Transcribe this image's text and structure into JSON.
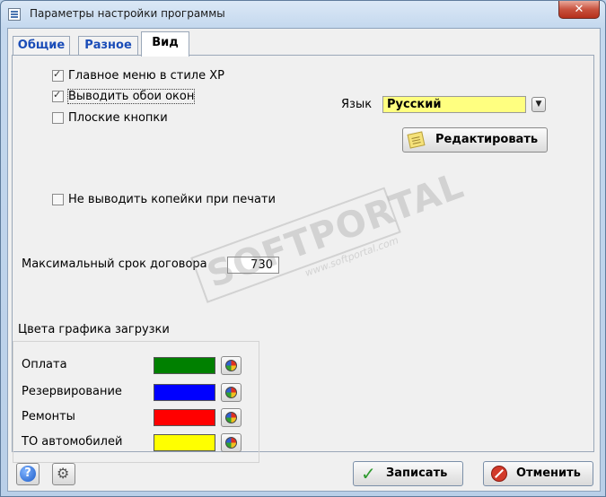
{
  "window": {
    "title": "Параметры настройки программы",
    "close_glyph": "✕",
    "app_icon": "settings-window-icon"
  },
  "tabs": [
    {
      "label": "Общие",
      "active": false
    },
    {
      "label": "Разное",
      "active": false
    },
    {
      "label": "Вид",
      "active": true
    }
  ],
  "view": {
    "checkboxes": [
      {
        "label": "Главное меню в стиле XP",
        "checked": true
      },
      {
        "label": "Выводить обои окон",
        "checked": true
      },
      {
        "label": "Плоские кнопки",
        "checked": false
      },
      {
        "label": "Не выводить копейки при печати",
        "checked": false
      }
    ],
    "language": {
      "label": "Язык",
      "value": "Русский",
      "field_color": "#ffff80"
    },
    "edit_button": {
      "label": "Редактировать",
      "icon": "note-icon"
    },
    "max_term": {
      "label": "Максимальный срок договора",
      "value": "730"
    },
    "colors": {
      "title": "Цвета графика загрузки",
      "items": [
        {
          "label": "Оплата",
          "color": "#008000"
        },
        {
          "label": "Резервирование",
          "color": "#0000ff"
        },
        {
          "label": "Ремонты",
          "color": "#ff0000"
        },
        {
          "label": "ТО автомобилей",
          "color": "#ffff00"
        }
      ]
    }
  },
  "watermark": {
    "main": "SOFTPORTAL",
    "sub": "www.softportal.com",
    "tm": "™"
  },
  "footer": {
    "help_icon": "help-icon",
    "tools_icon": "tools-icon",
    "save_label": "Записать",
    "cancel_label": "Отменить"
  }
}
